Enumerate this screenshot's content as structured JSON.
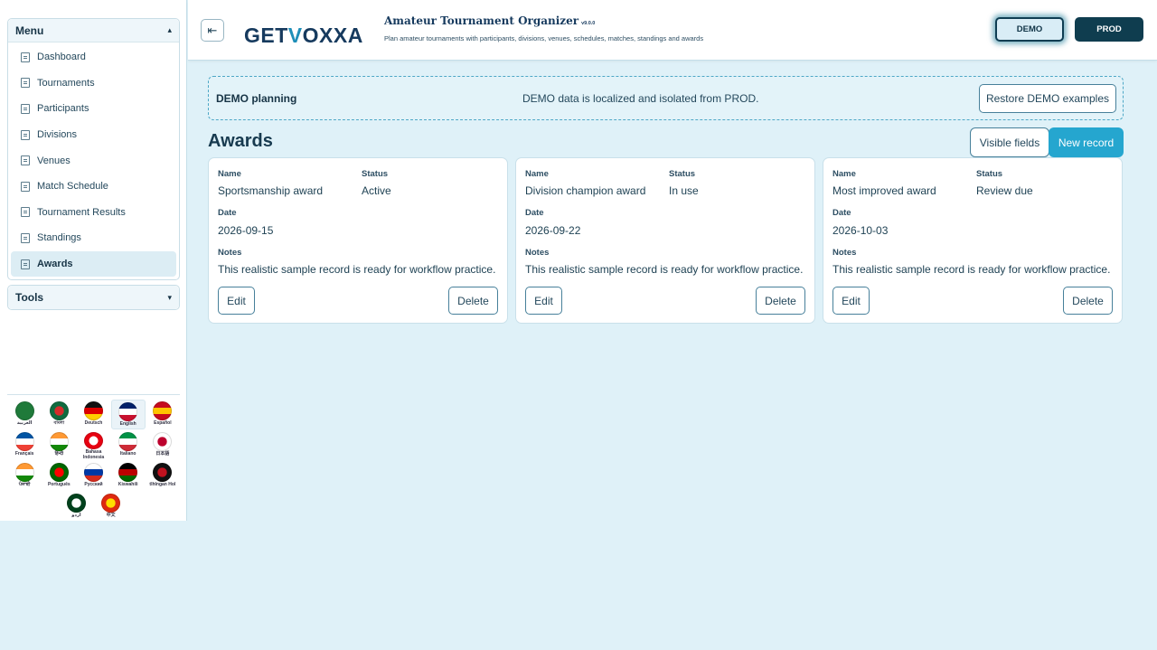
{
  "sidebar": {
    "menu_title": "Menu",
    "items": [
      {
        "label": "Dashboard"
      },
      {
        "label": "Tournaments"
      },
      {
        "label": "Participants"
      },
      {
        "label": "Divisions"
      },
      {
        "label": "Venues"
      },
      {
        "label": "Match Schedule"
      },
      {
        "label": "Tournament Results"
      },
      {
        "label": "Standings"
      },
      {
        "label": "Awards",
        "active": true
      }
    ],
    "tools_title": "Tools",
    "languages": [
      {
        "name": "العربية",
        "colors": [
          "#1f7a3a",
          "#1f7a3a"
        ]
      },
      {
        "name": "বাংলা",
        "colors": [
          "#0f6b3f",
          "#d62b2b"
        ]
      },
      {
        "name": "Deutsch",
        "colors": [
          "#111111",
          "#dd0000",
          "#ffce00"
        ]
      },
      {
        "name": "English",
        "colors": [
          "#012169",
          "#ffffff",
          "#c8102e"
        ],
        "selected": true
      },
      {
        "name": "Español",
        "colors": [
          "#c60b1e",
          "#ffc400",
          "#c60b1e"
        ]
      },
      {
        "name": "Français",
        "colors": [
          "#0055a4",
          "#ffffff",
          "#ef4135"
        ]
      },
      {
        "name": "हिन्दी",
        "colors": [
          "#ff9933",
          "#ffffff",
          "#138808"
        ]
      },
      {
        "name": "Bahasa Indonesia",
        "colors": [
          "#e70011",
          "#ffffff"
        ]
      },
      {
        "name": "Italiano",
        "colors": [
          "#009246",
          "#ffffff",
          "#ce2b37"
        ]
      },
      {
        "name": "日本語",
        "colors": [
          "#ffffff",
          "#bc002d"
        ]
      },
      {
        "name": "ਪੰਜਾਬੀ",
        "colors": [
          "#ff9933",
          "#ffffff",
          "#138808"
        ]
      },
      {
        "name": "Português",
        "colors": [
          "#006600",
          "#ff0000"
        ]
      },
      {
        "name": "Русский",
        "colors": [
          "#ffffff",
          "#0039a6",
          "#d52b1e"
        ]
      },
      {
        "name": "Kiswahili",
        "colors": [
          "#000000",
          "#bb0000",
          "#006600"
        ]
      },
      {
        "name": "tlhIngan Hol",
        "colors": [
          "#111111",
          "#c1121f"
        ]
      },
      {
        "name": "اردو",
        "colors": [
          "#01411c",
          "#ffffff"
        ]
      },
      {
        "name": "中文",
        "colors": [
          "#de2910",
          "#ffde00"
        ]
      }
    ]
  },
  "header": {
    "toggle_icon": "⇤",
    "logo_pre": "GET",
    "logo_v": "V",
    "logo_post": "OXXA",
    "app_title": "Amateur Tournament Organizer",
    "app_version": "v9.0.0",
    "app_subtitle": "Plan amateur tournaments with participants, divisions, venues, schedules, matches, standings and awards",
    "demo_label": "DEMO",
    "prod_label": "PROD"
  },
  "banner": {
    "title": "DEMO planning",
    "message": "DEMO data is localized and isolated from PROD.",
    "restore_label": "Restore DEMO examples"
  },
  "page": {
    "title": "Awards",
    "visible_fields_label": "Visible fields",
    "new_record_label": "New record"
  },
  "labels": {
    "name": "Name",
    "status": "Status",
    "date": "Date",
    "notes": "Notes",
    "edit": "Edit",
    "delete": "Delete"
  },
  "records": [
    {
      "name": "Sportsmanship award",
      "status": "Active",
      "date": "2026-09-15",
      "notes": "This realistic sample record is ready for workflow practice."
    },
    {
      "name": "Division champion award",
      "status": "In use",
      "date": "2026-09-22",
      "notes": "This realistic sample record is ready for workflow practice."
    },
    {
      "name": "Most improved award",
      "status": "Review due",
      "date": "2026-10-03",
      "notes": "This realistic sample record is ready for workflow practice."
    }
  ]
}
